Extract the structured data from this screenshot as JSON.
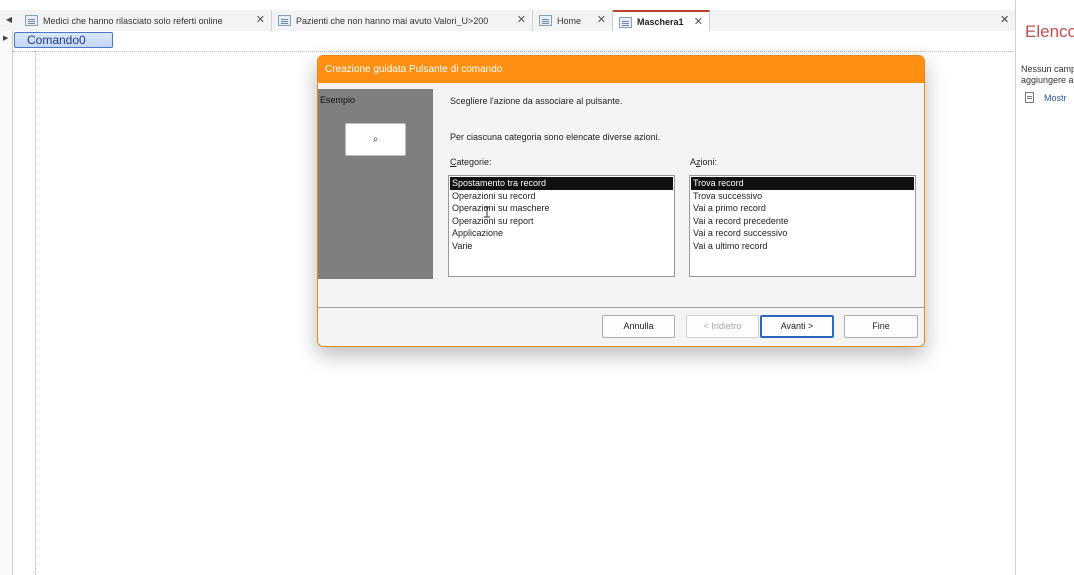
{
  "tabs": [
    {
      "label": "Medici che hanno rilasciato solo referti online",
      "active": false,
      "icon": "query-icon"
    },
    {
      "label": "Pazienti che non hanno mai avuto Valori_U>200",
      "active": false,
      "icon": "query-icon"
    },
    {
      "label": "Home",
      "active": false,
      "icon": "form-icon"
    },
    {
      "label": "Maschera1",
      "active": true,
      "icon": "form-icon"
    }
  ],
  "design": {
    "command_button_label": "Comando0"
  },
  "field_pane": {
    "title": "Elenco",
    "message": "Nessun camp aggiungere a",
    "link": "Mostr"
  },
  "wizard": {
    "title": "Creazione guidata Pulsante di comando",
    "sample_label": "Esempio",
    "prompt": "Scegliere l'azione da associare al pulsante.",
    "info": "Per ciascuna categoria sono elencate diverse azioni.",
    "categories_label_key": "C",
    "categories_label_rest": "ategorie:",
    "actions_label_pre": "A",
    "actions_label_key": "z",
    "actions_label_rest": "ioni:",
    "categories": [
      "Spostamento tra record",
      "Operazioni su record",
      "Operazioni su maschere",
      "Operazioni su report",
      "Applicazione",
      "Varie"
    ],
    "selected_category": "Spostamento tra record",
    "actions": [
      "Trova record",
      "Trova successivo",
      "Vai a primo record",
      "Vai a record precedente",
      "Vai a record successivo",
      "Vai a ultimo record"
    ],
    "selected_action": "Trova record",
    "buttons": {
      "cancel": "Annulla",
      "back": "< Indietro",
      "next": "Avanti >",
      "finish": "Fine"
    }
  },
  "colors": {
    "title_bar": "#fd9013",
    "sample_panel": "#7f7f7f",
    "active_tab_accent": "#b8422a",
    "pane_title": "#c0504d"
  }
}
